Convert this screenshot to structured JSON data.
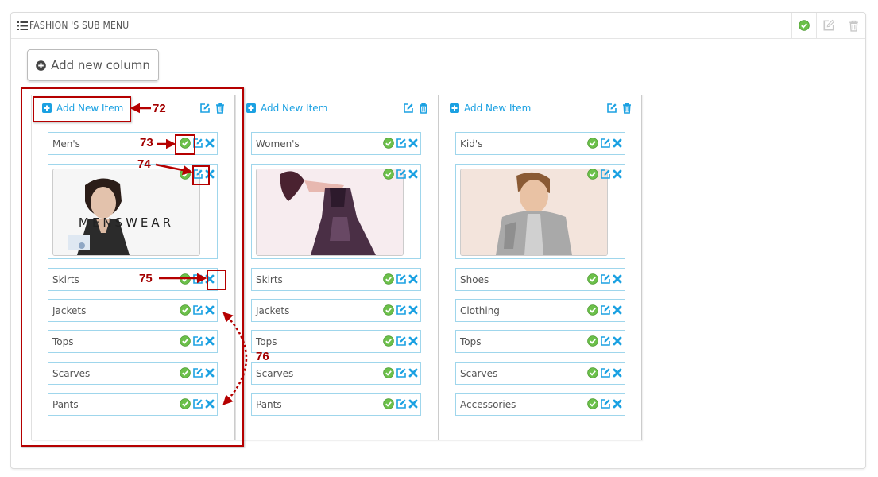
{
  "panel": {
    "title": "FASHION 'S SUB MENU"
  },
  "toolbar": {
    "add_column_label": "Add new column"
  },
  "columns": [
    {
      "add_item_label": "Add New Item",
      "items": [
        "Men's",
        "Skirts",
        "Jackets",
        "Tops",
        "Scarves",
        "Pants"
      ],
      "image_caption": "MENSWEAR"
    },
    {
      "add_item_label": "Add New Item",
      "items": [
        "Women's",
        "Skirts",
        "Jackets",
        "Tops",
        "Scarves",
        "Pants"
      ]
    },
    {
      "add_item_label": "Add New Item",
      "items": [
        "Kid's",
        "Shoes",
        "Clothing",
        "Tops",
        "Scarves",
        "Accessories"
      ]
    }
  ],
  "annotations": [
    "72",
    "73",
    "74",
    "75",
    "76"
  ],
  "colors": {
    "accent": "#1ba1e2",
    "approve": "#6cc04a",
    "annotation": "#a30000"
  }
}
